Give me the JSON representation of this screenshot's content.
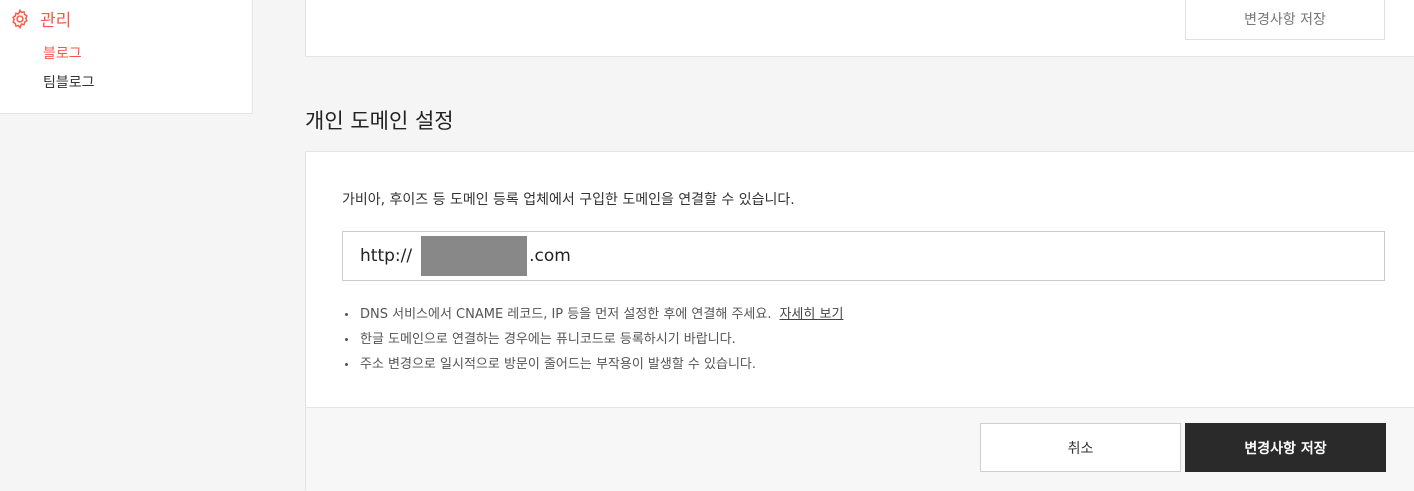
{
  "sidebar": {
    "manage_label": "관리",
    "items": [
      {
        "label": "블로그",
        "active": true
      },
      {
        "label": "팀블로그",
        "active": false
      }
    ]
  },
  "top_section": {
    "save_label": "변경사항 저장"
  },
  "domain_section": {
    "title": "개인 도메인 설정",
    "description": "가비아, 후이즈 등 도메인 등록 업체에서 구입한 도메인을 연결할 수 있습니다.",
    "url_prefix": "http://",
    "url_suffix": ".com",
    "notes": [
      {
        "text": "DNS 서비스에서 CNAME 레코드, IP 등을 먼저 설정한 후에 연결해 주세요.",
        "link": "자세히 보기"
      },
      {
        "text": "한글 도메인으로 연결하는 경우에는 퓨니코드로 등록하시기 바랍니다."
      },
      {
        "text": "주소 변경으로 일시적으로 방문이 줄어드는 부작용이 발생할 수 있습니다."
      }
    ],
    "cancel_label": "취소",
    "save_label": "변경사항 저장"
  },
  "colors": {
    "accent": "#ff5544",
    "dark_button": "#2a2a2a",
    "page_bg": "#f5f5f5"
  }
}
